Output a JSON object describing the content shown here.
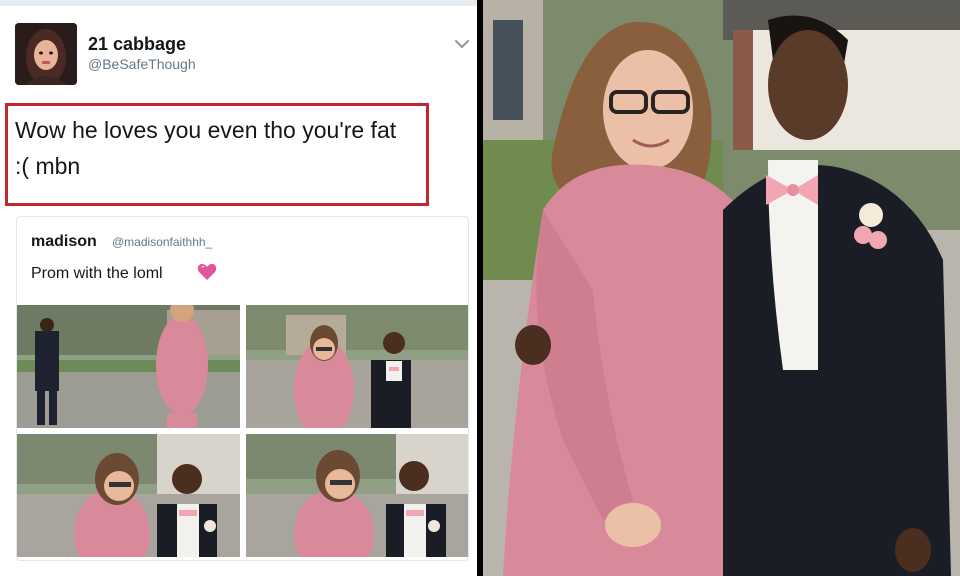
{
  "tweet": {
    "display_name": "21 cabbage",
    "handle": "@BeSafeThough",
    "text_line1": "Wow he loves you even tho you're fat",
    "text_line2": ":( mbn"
  },
  "quoted_tweet": {
    "display_name": "madison",
    "handle": "@madisonfaithhh_",
    "text": "Prom with the loml"
  },
  "colors": {
    "highlight_box": "#c1272d",
    "dress": "#d98a9a",
    "suit": "#1b1d26",
    "bow_tie": "#f2a6b3"
  },
  "icons": [
    "chevron-down-icon",
    "heart-emoji-icon"
  ]
}
